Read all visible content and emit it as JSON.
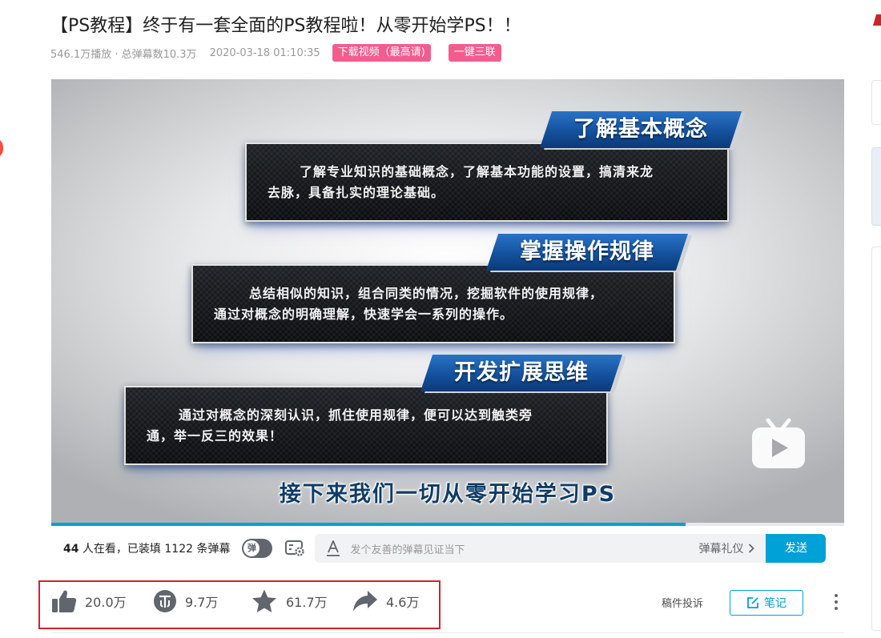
{
  "video": {
    "title": "【PS教程】终于有一套全面的PS教程啦！从零开始学PS！！",
    "stats": "546.1万播放 · 总弹幕数10.3万",
    "date": "2020-03-18 01:10:35",
    "download_label": "下载视频（最高请)",
    "triple_label": "一键三联",
    "progress": 0.8
  },
  "frame": {
    "cards": [
      {
        "heading": "了解基本概念",
        "line1": "了解专业知识的基础概念，了解基本功能的设置，搞清来龙",
        "line2": "去脉，具备扎实的理论基础。"
      },
      {
        "heading": "掌握操作规律",
        "line1": "总结相似的知识，组合同类的情况，挖掘软件的使用规律，",
        "line2": "通过对概念的明确理解，快速学会一系列的操作。"
      },
      {
        "heading": "开发扩展思维",
        "line1": "通过对概念的深刻认识，抓住使用规律，便可以达到触类旁",
        "line2": "通，举一反三的效果！"
      }
    ],
    "caption": "接下来我们一切从零开始学习PS"
  },
  "danmaku": {
    "viewer_count": "44",
    "viewer_text": " 人在看，已装填 1122 条弹幕",
    "toggle_label": "弹",
    "placeholder": "发个友善的弹幕见证当下",
    "etiquette_label": "弹幕礼仪",
    "send_label": "发送"
  },
  "actions": {
    "like": "20.0万",
    "coin": "9.7万",
    "favorite": "61.7万",
    "share": "4.6万",
    "report": "稿件投诉",
    "note": "笔记"
  },
  "colors": {
    "accent": "#00a1d6",
    "pink": "#f25d8e",
    "highlight": "#d3222a",
    "banner_blue": "#14519d"
  }
}
